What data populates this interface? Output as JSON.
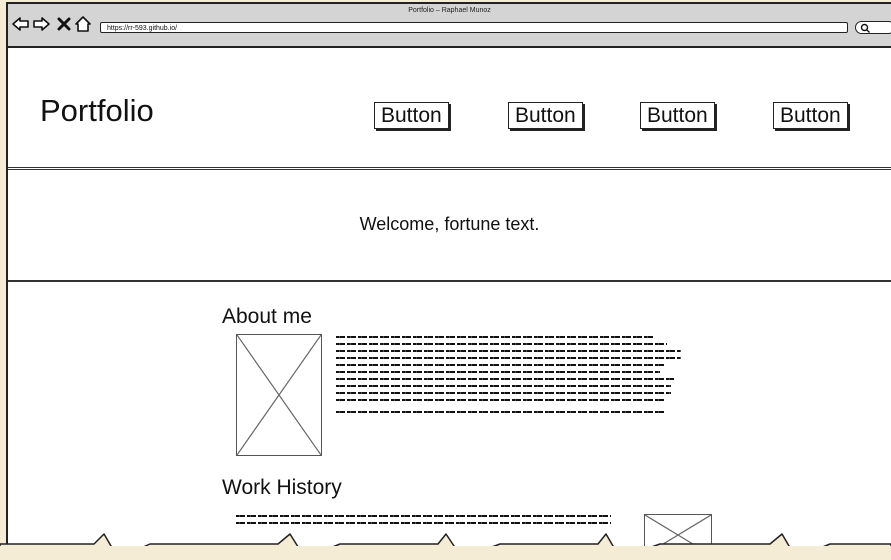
{
  "window": {
    "title": "Portfolio – Raphael Munoz",
    "url": "https://rr-593.github.io/"
  },
  "header": {
    "logo": "Portfolio",
    "buttons": [
      {
        "label": "Button"
      },
      {
        "label": "Button"
      },
      {
        "label": "Button"
      },
      {
        "label": "Button"
      }
    ]
  },
  "hero": {
    "text": "Welcome, fortune text."
  },
  "about": {
    "title": "About me"
  },
  "work": {
    "title": "Work History"
  },
  "colors": {
    "background": "#f5ecd6",
    "chrome": "#d4d4d4",
    "ink": "#111111"
  }
}
